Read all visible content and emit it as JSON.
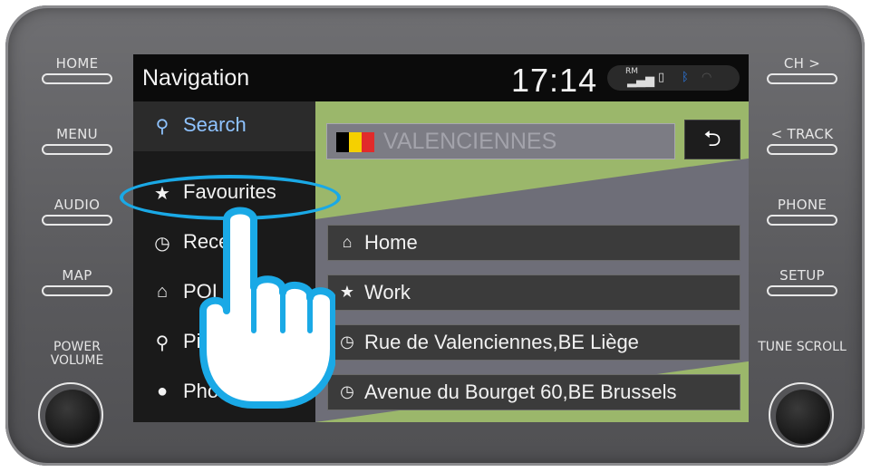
{
  "device": {
    "left_buttons": [
      "HOME",
      "MENU",
      "AUDIO",
      "MAP"
    ],
    "right_buttons": [
      "CH >",
      "< TRACK",
      "PHONE",
      "SETUP"
    ],
    "left_knob_label": "POWER VOLUME",
    "right_knob_label": "TUNE SCROLL"
  },
  "screen": {
    "title": "Navigation",
    "clock": "17:14",
    "status_icons": [
      "signal-icon",
      "phone-icon",
      "bluetooth-icon",
      "wifi-icon"
    ],
    "status_rm": "RM"
  },
  "sidebar": {
    "items": [
      {
        "label": "Search",
        "icon": "search-icon",
        "active": true
      },
      {
        "label": "Favourites",
        "icon": "star-icon",
        "active": false
      },
      {
        "label": "Recent",
        "icon": "clock-icon",
        "active": false
      },
      {
        "label": "POI",
        "icon": "poi-icon",
        "active": false
      },
      {
        "label": "Pin",
        "icon": "pin-icon",
        "active": false
      },
      {
        "label": "Phonebook",
        "icon": "person-icon",
        "active": false
      }
    ]
  },
  "search": {
    "country_flag": [
      "#000000",
      "#f5d000",
      "#e12b2b"
    ],
    "city_placeholder": "VALENCIENNES"
  },
  "favourites": [
    {
      "label": "Home",
      "icon": "home-icon"
    },
    {
      "label": "Work",
      "icon": "star-icon"
    },
    {
      "label": "Rue de Valenciennes,BE Liège",
      "icon": "clock-icon"
    },
    {
      "label": "Avenue du Bourget 60,BE Brussels",
      "icon": "clock-icon"
    }
  ],
  "colors": {
    "accent": "#1aa9e6",
    "map_green": "#9bb76b"
  }
}
